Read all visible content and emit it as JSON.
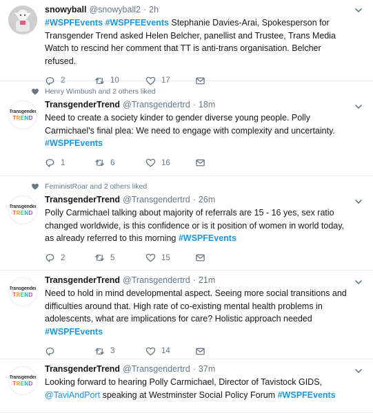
{
  "colors": {
    "link": "#1b95e0",
    "text": "#14171a",
    "muted": "#657786",
    "border": "#e6ecf0"
  },
  "tweets": [
    {
      "social_context": "",
      "name": "snowyball",
      "handle": "@snowyball2",
      "time": "2h",
      "avatar_icon": "avatar-snowyball",
      "segments": [
        {
          "type": "hashtag",
          "text": "#WSPFEvents"
        },
        {
          "type": "text",
          "text": " "
        },
        {
          "type": "hashtag",
          "text": "#WSPFEEvents"
        },
        {
          "type": "text",
          "text": " Stephanie Davies-Arai, Spokesperson for Transgender Trend asked Helen Belcher, panellist and Trustee, Trans Media Watch to rescind her comment that TT is anti-trans organisation. Belcher refused."
        }
      ],
      "replies": "2",
      "retweets": "10",
      "likes": "17"
    },
    {
      "social_context": "Henry Wimbush and 2 others liked",
      "name": "TransgenderTrend",
      "handle": "@Transgendertrd",
      "time": "18m",
      "avatar_icon": "avatar-transgendertrend",
      "segments": [
        {
          "type": "text",
          "text": "Need to create a society kinder to gender diverse young people. Polly Carmichael's final plea:  We need to engage with complexity and uncertainty. "
        },
        {
          "type": "hashtag",
          "text": "#WSPFEvents"
        }
      ],
      "replies": "1",
      "retweets": "6",
      "likes": "16"
    },
    {
      "social_context": "FeministRoar and 2 others liked",
      "name": "TransgenderTrend",
      "handle": "@Transgendertrd",
      "time": "26m",
      "avatar_icon": "avatar-transgendertrend",
      "segments": [
        {
          "type": "text",
          "text": "Polly Carmichael talking about majority of referrals are 15 - 16 yes, sex ratio changed worldwide, is this confidence or is it position of women in world today, as already referred to this morning "
        },
        {
          "type": "hashtag",
          "text": "#WSPFEvents"
        }
      ],
      "replies": "2",
      "retweets": "5",
      "likes": "15"
    },
    {
      "social_context": "",
      "name": "TransgenderTrend",
      "handle": "@Transgendertrd",
      "time": "21m",
      "avatar_icon": "avatar-transgendertrend",
      "segments": [
        {
          "type": "text",
          "text": "Need to hold in mind developmental aspect. Seeing more social transitions and difficulties around that. High rate of co-existing mental health problems in adolescents, what are implications for care? Holistic approach needed "
        },
        {
          "type": "hashtag",
          "text": "#WSPFEvents"
        }
      ],
      "replies": "",
      "retweets": "3",
      "likes": "14"
    },
    {
      "social_context": "",
      "name": "TransgenderTrend",
      "handle": "@Transgendertrd",
      "time": "37m",
      "avatar_icon": "avatar-transgendertrend",
      "segments": [
        {
          "type": "text",
          "text": "Looking forward to hearing Polly Carmichael, Director of Tavistock GIDS, "
        },
        {
          "type": "mention",
          "text": "@TaviAndPort"
        },
        {
          "type": "text",
          "text": " speaking at Westminster Social Policy Forum "
        },
        {
          "type": "hashtag",
          "text": "#WSPFEvents"
        }
      ],
      "replies": "",
      "retweets": "",
      "likes": ""
    }
  ],
  "avatar_tt": {
    "line1": "Transgender",
    "line2": "TREND"
  }
}
